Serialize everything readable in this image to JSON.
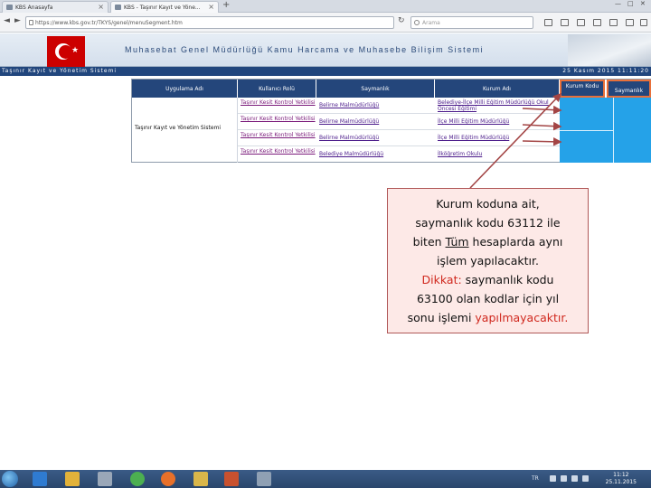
{
  "browser": {
    "tabs": [
      {
        "label": "KBS Anasayfa"
      },
      {
        "label": "KBS - Taşınır Kayıt ve Yöne..."
      }
    ],
    "new_tab_glyph": "+",
    "tab_close_glyph": "×",
    "url": "https://www.kbs.gov.tr/TKYS/genel/menuSegment.htm",
    "search_placeholder": "Arama",
    "window_controls": [
      "—",
      "□",
      "✕"
    ]
  },
  "site": {
    "title": "Muhasebat Genel Müdürlüğü Kamu Harcama ve Muhasebe Bilişim Sistemi",
    "subsystem": "Taşınır Kayıt ve Yönetim Sistemi",
    "datetime": "25 Kasım 2015 11:11:20"
  },
  "table": {
    "headers": [
      "Uygulama Adı",
      "Kullanıcı Rolü",
      "Saymanlık",
      "Kurum Adı",
      "Kurum Kodu",
      "Saymanlık"
    ],
    "application": "Taşınır Kayıt ve Yönetim Sistemi",
    "rows": [
      {
        "role": "Taşınır Kesit Kontrol Yetkilisi",
        "saymanlik": "Belirne Malmüdürlüğü",
        "kurum": "Belediye-İlçe Milli Eğitim Müdürlüğü Okul Öncesi Eğitimi"
      },
      {
        "role": "Taşınır Kesit Kontrol Yetkilisi",
        "saymanlik": "Belirne Malmüdürlüğü",
        "kurum": "İlçe Milli Eğitim Müdürlüğü"
      },
      {
        "role": "Taşınır Kesit Kontrol Yetkilisi",
        "saymanlik": "Belirne Malmüdürlüğü",
        "kurum": "İlçe Milli Eğitim Müdürlüğü"
      },
      {
        "role": "Taşınır Kesit Kontrol Yetkilisi",
        "saymanlik": "Belediye Malmüdürlüğü",
        "kurum": "İlköğretim Okulu"
      }
    ]
  },
  "callout": {
    "line1": "Kurum koduna ait,",
    "line2": "saymanlık kodu 63112 ile",
    "line3_pre": "biten ",
    "line3_u": "Tüm",
    "line3_post": " hesaplarda aynı",
    "line4": "işlem yapılacaktır.",
    "warn_label": "Dikkat:",
    "line5": "  saymanlık  kodu",
    "line6": "63100 olan kodlar için yıl",
    "line7_pre": "sonu işlemi ",
    "line7_red": "yapılmayacaktır."
  },
  "taskbar": {
    "clock_time": "11:12",
    "clock_date": "25.11.2015",
    "tray_text": "TR"
  },
  "colors": {
    "header_navy": "#24467b",
    "highlight_orange": "#e8703a",
    "code_blue": "#25a2e8",
    "callout_bg": "#fde9e7",
    "warning_red": "#d0281e"
  }
}
